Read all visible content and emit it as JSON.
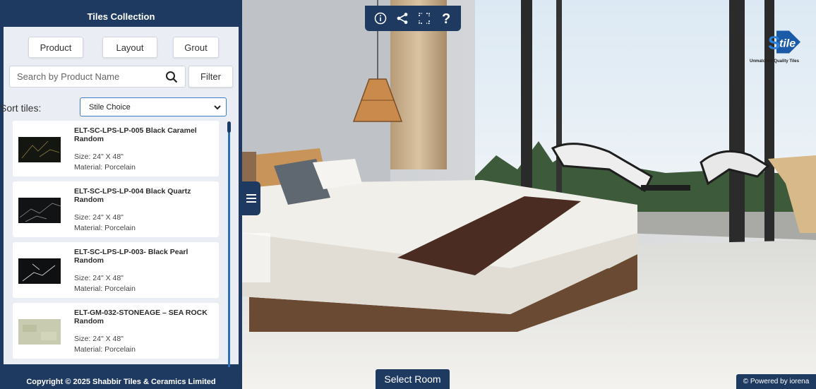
{
  "panel": {
    "title": "Tiles Collection",
    "tabs": [
      {
        "label": "Product"
      },
      {
        "label": "Layout"
      },
      {
        "label": "Grout"
      }
    ],
    "search": {
      "placeholder": "Search by Product Name"
    },
    "filter_label": "Filter",
    "sort": {
      "label": "Sort tiles:",
      "selected": "Stile Choice"
    },
    "products": [
      {
        "title": "ELT-SC-LPS-LP-005 Black Caramel Random",
        "size": "Size: 24\" X 48\"",
        "material": "Material: Porcelain"
      },
      {
        "title": "ELT-SC-LPS-LP-004 Black Quartz Random",
        "size": "Size: 24\" X 48\"",
        "material": "Material: Porcelain"
      },
      {
        "title": "ELT-SC-LPS-LP-003- Black Pearl Random",
        "size": "Size: 24\" X 48\"",
        "material": "Material: Porcelain"
      },
      {
        "title": "ELT-GM-032-STONEAGE – SEA ROCK Random",
        "size": "Size: 24\" X 48\"",
        "material": "Material: Porcelain"
      }
    ],
    "footer": "Copyright © 2025 Shabbir Tiles & Ceramics Limited"
  },
  "toolbar": {
    "icons": [
      "info-icon",
      "share-icon",
      "fullscreen-icon",
      "help-icon"
    ]
  },
  "logo": {
    "tagline": "Unmatched Quality Tiles"
  },
  "select_room_label": "Select Room",
  "powered_label": "© Powered by iorena",
  "colors": {
    "brand_navy": "#1f3a60",
    "accent_blue": "#2d6fb5",
    "panel_bg": "#eaedf3"
  }
}
